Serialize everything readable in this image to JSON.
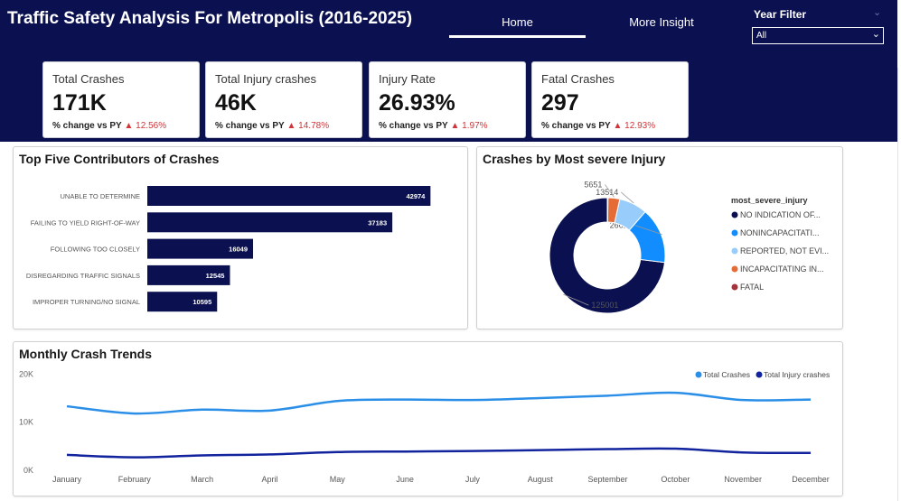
{
  "header": {
    "title": "Traffic Safety Analysis For Metropolis (2016-2025)",
    "nav": {
      "home": "Home",
      "more_insight": "More Insight"
    },
    "year_filter": {
      "label": "Year Filter",
      "selected": "All"
    }
  },
  "kpis": [
    {
      "label": "Total Crashes",
      "value": "171K",
      "change_label": "% change vs PY",
      "change": "12.56%"
    },
    {
      "label": "Total Injury crashes",
      "value": "46K",
      "change_label": "% change vs PY",
      "change": "14.78%"
    },
    {
      "label": "Injury Rate",
      "value": "26.93%",
      "change_label": "% change vs PY",
      "change": "1.97%"
    },
    {
      "label": "Fatal Crashes",
      "value": "297",
      "change_label": "% change vs PY",
      "change": "12.93%"
    }
  ],
  "colors": {
    "navy": "#0b1150",
    "blue": "#118dff",
    "light_blue": "#98cdfb",
    "orange": "#e66c37",
    "maroon": "#a4343a",
    "line_total": "#2b8fe8",
    "line_injury": "#12239e",
    "negative": "#d13438"
  },
  "chart_data": [
    {
      "type": "bar",
      "title": "Top Five Contributors of Crashes",
      "orientation": "horizontal",
      "categories": [
        "UNABLE TO DETERMINE",
        "FAILING TO YIELD RIGHT-OF-WAY",
        "FOLLOWING TOO CLOSELY",
        "DISREGARDING TRAFFIC SIGNALS",
        "IMPROPER TURNING/NO SIGNAL"
      ],
      "values": [
        42974,
        37183,
        16049,
        12545,
        10595
      ],
      "value_labels": [
        "42974",
        "37183",
        "16049",
        "12545",
        "10595"
      ],
      "xlim": [
        0,
        48000
      ]
    },
    {
      "type": "pie",
      "title": "Crashes by Most severe Injury",
      "donut": true,
      "legend_title": "most_severe_injury",
      "legend_position": "right",
      "labels": [
        "NO INDICATION OF...",
        "NONINCAPACITATI...",
        "REPORTED, NOT EVI...",
        "INCAPACITATING IN...",
        "FATAL"
      ],
      "values": [
        125001,
        26610,
        13514,
        5651,
        297
      ],
      "value_labels": [
        "125001",
        "26610",
        "13514",
        "5651",
        ""
      ]
    },
    {
      "type": "line",
      "title": "Monthly Crash Trends",
      "legend_position": "top-right",
      "x": [
        "January",
        "February",
        "March",
        "April",
        "May",
        "June",
        "July",
        "August",
        "September",
        "October",
        "November",
        "December"
      ],
      "y_tick_labels": [
        "0K",
        "10K",
        "20K"
      ],
      "y_ticks": [
        0,
        10000,
        20000
      ],
      "ylim": [
        0,
        21000
      ],
      "series": [
        {
          "name": "Total Crashes",
          "values": [
            13300,
            11800,
            12600,
            12400,
            14400,
            14700,
            14600,
            15000,
            15500,
            16100,
            14600,
            14700
          ]
        },
        {
          "name": "Total Injury crashes",
          "values": [
            3200,
            2700,
            3100,
            3300,
            3800,
            3900,
            4000,
            4200,
            4400,
            4500,
            3700,
            3600
          ]
        }
      ]
    }
  ]
}
